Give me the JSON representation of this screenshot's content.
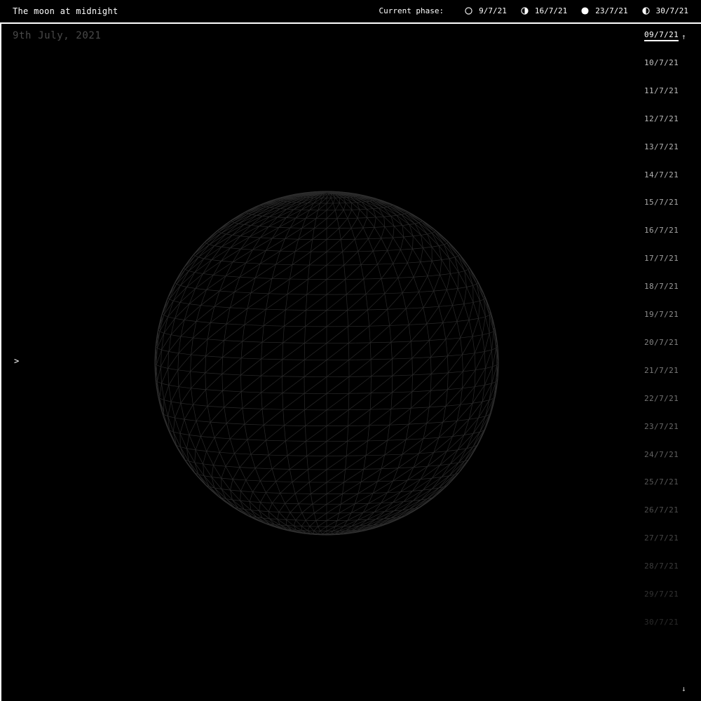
{
  "header": {
    "title": "The moon at midnight",
    "phase_label": "Current phase:",
    "phases": [
      {
        "icon": "new-moon-icon",
        "date": "9/7/21"
      },
      {
        "icon": "first-quarter-moon-icon",
        "date": "16/7/21"
      },
      {
        "icon": "full-moon-icon",
        "date": "23/7/21"
      },
      {
        "icon": "last-quarter-moon-icon",
        "date": "30/7/21"
      }
    ]
  },
  "main": {
    "current_date": "9th July, 2021",
    "prev_arrow": ">",
    "moon_illumination": 0
  },
  "date_list": {
    "items": [
      "09/7/21",
      "10/7/21",
      "11/7/21",
      "12/7/21",
      "13/7/21",
      "14/7/21",
      "15/7/21",
      "16/7/21",
      "17/7/21",
      "18/7/21",
      "19/7/21",
      "20/7/21",
      "21/7/21",
      "22/7/21",
      "23/7/21",
      "24/7/21",
      "25/7/21",
      "26/7/21",
      "27/7/21",
      "28/7/21",
      "29/7/21",
      "30/7/21"
    ],
    "selected": "09/7/21",
    "scroll_up": "↑",
    "scroll_down": "↓"
  },
  "colors": {
    "background": "#000000",
    "foreground": "#ffffff",
    "muted_date": "#4a4a4a",
    "wireframe": "#2a2a2a"
  }
}
